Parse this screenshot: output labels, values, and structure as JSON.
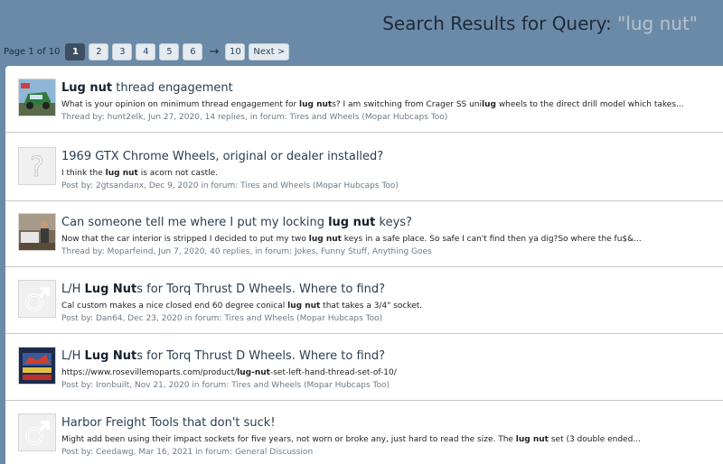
{
  "header": {
    "title_prefix": "Search Results for Query: ",
    "query": "\"lug nut\""
  },
  "pager": {
    "label": "Page 1 of 10",
    "pages": [
      "1",
      "2",
      "3",
      "4",
      "5",
      "6"
    ],
    "current": "1",
    "arrow": "→",
    "last": "10",
    "next": "Next >"
  },
  "results": [
    {
      "avatar": "car-photo",
      "title_parts": [
        {
          "t": "Lug nut",
          "b": true
        },
        {
          "t": " thread engagement",
          "b": false
        }
      ],
      "snippet_parts": [
        {
          "t": "What is your opinion on minimum thread engagement for ",
          "b": false
        },
        {
          "t": "lug nut",
          "b": true
        },
        {
          "t": "s? I am switching from Crager SS uni",
          "b": false
        },
        {
          "t": "lug",
          "b": true
        },
        {
          "t": " wheels to the direct drill model which takes...",
          "b": false
        }
      ],
      "meta_kind": "Thread by: ",
      "author": "hunt2elk",
      "meta_info": ", Jun 27, 2020, 14 replies, in forum: ",
      "forum": "Tires and Wheels (Mopar Hubcaps Too)"
    },
    {
      "avatar": "question-mark",
      "title_parts": [
        {
          "t": "1969 GTX Chrome Wheels, original or dealer installed?",
          "b": false
        }
      ],
      "snippet_parts": [
        {
          "t": "I think the ",
          "b": false
        },
        {
          "t": "lug nut",
          "b": true
        },
        {
          "t": " is acorn not castle.",
          "b": false
        }
      ],
      "meta_kind": "Post by: ",
      "author": "2gtsandanx",
      "meta_info": ", Dec 9, 2020 in forum: ",
      "forum": "Tires and Wheels (Mopar Hubcaps Too)"
    },
    {
      "avatar": "person-photo",
      "title_parts": [
        {
          "t": "Can someone tell me where I put my locking ",
          "b": false
        },
        {
          "t": "lug nut",
          "b": true
        },
        {
          "t": " keys?",
          "b": false
        }
      ],
      "snippet_parts": [
        {
          "t": "Now that the car interior is stripped I decided to put my two ",
          "b": false
        },
        {
          "t": "lug nut",
          "b": true
        },
        {
          "t": " keys in a safe place. So safe I can't find then ya dig?So where the fu$&...",
          "b": false
        }
      ],
      "meta_kind": "Thread by: ",
      "author": "Moparfeind",
      "meta_info": ", Jun 7, 2020, 40 replies, in forum: ",
      "forum": "Jokes, Funny Stuff, Anything Goes"
    },
    {
      "avatar": "male-symbol",
      "title_parts": [
        {
          "t": "L/H ",
          "b": false
        },
        {
          "t": "Lug Nut",
          "b": true
        },
        {
          "t": "s for Torq Thrust D Wheels. Where to find?",
          "b": false
        }
      ],
      "snippet_parts": [
        {
          "t": "Cal custom makes a nice closed end 60 degree conical ",
          "b": false
        },
        {
          "t": "lug nut",
          "b": true
        },
        {
          "t": " that takes a 3/4\" socket.",
          "b": false
        }
      ],
      "meta_kind": "Post by: ",
      "author": "Dan64",
      "meta_info": ", Dec 23, 2020 in forum: ",
      "forum": "Tires and Wheels (Mopar Hubcaps Too)"
    },
    {
      "avatar": "poster-image",
      "title_parts": [
        {
          "t": "L/H ",
          "b": false
        },
        {
          "t": "Lug Nut",
          "b": true
        },
        {
          "t": "s for Torq Thrust D Wheels. Where to find?",
          "b": false
        }
      ],
      "snippet_parts": [
        {
          "t": "https://www.rosevillemoparts.com/product/",
          "b": false
        },
        {
          "t": "lug-nut",
          "b": true
        },
        {
          "t": "-set-left-hand-thread-set-of-10/",
          "b": false
        }
      ],
      "meta_kind": "Post by: ",
      "author": "Ironbuilt",
      "meta_info": ", Nov 21, 2020 in forum: ",
      "forum": "Tires and Wheels (Mopar Hubcaps Too)"
    },
    {
      "avatar": "male-symbol",
      "title_parts": [
        {
          "t": "Harbor Freight Tools that don't suck!",
          "b": false
        }
      ],
      "snippet_parts": [
        {
          "t": "Might add been using their impact sockets for five years, not worn or broke any, just hard to read the size. The ",
          "b": false
        },
        {
          "t": "lug nut",
          "b": true
        },
        {
          "t": " set (3 double ended...",
          "b": false
        }
      ],
      "meta_kind": "Post by: ",
      "author": "Ceedawg",
      "meta_info": ", Mar 16, 2021 in forum: ",
      "forum": "General Discussion"
    }
  ]
}
